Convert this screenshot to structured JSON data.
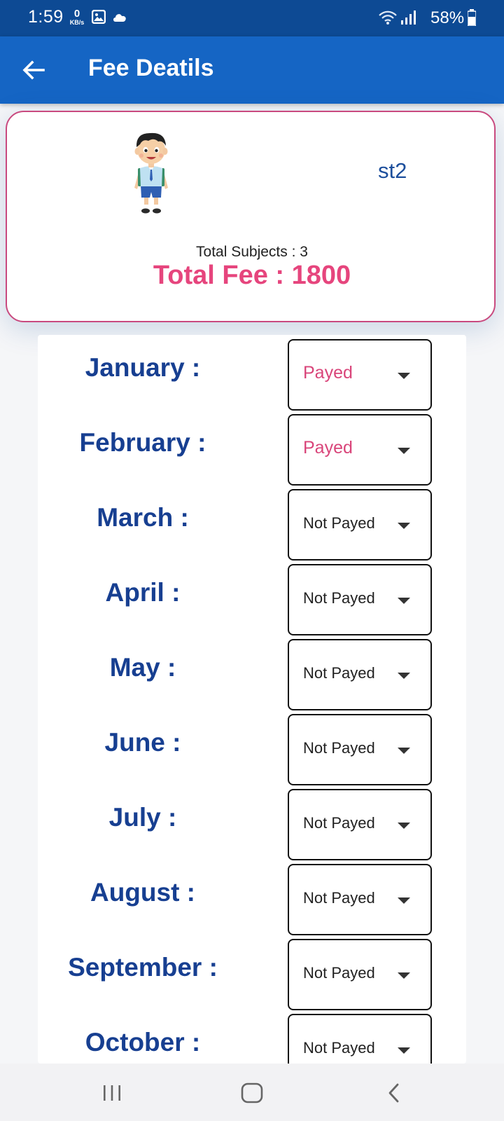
{
  "status_bar": {
    "time": "1:59",
    "data_rate_value": "0",
    "data_rate_unit": "KB/s",
    "battery_text": "58%",
    "icons": [
      "gallery-icon",
      "cloud-icon",
      "wifi-icon",
      "signal-icon",
      "battery-icon"
    ]
  },
  "app_bar": {
    "title": "Fee Deatils",
    "back_icon": "arrow-left-icon",
    "color": "#1565c4"
  },
  "profile": {
    "student_name": "st2",
    "total_subjects": "Total Subjects : 3",
    "total_fee": "Total Fee : 1800",
    "accent_color": "#e6457d"
  },
  "months": [
    {
      "label": "January :",
      "status": "Payed",
      "paid": true
    },
    {
      "label": "February :",
      "status": "Payed",
      "paid": true
    },
    {
      "label": "March :",
      "status": "Not Payed",
      "paid": false
    },
    {
      "label": "April :",
      "status": "Not Payed",
      "paid": false
    },
    {
      "label": "May :",
      "status": "Not Payed",
      "paid": false
    },
    {
      "label": "June :",
      "status": "Not Payed",
      "paid": false
    },
    {
      "label": "July :",
      "status": "Not Payed",
      "paid": false
    },
    {
      "label": "August :",
      "status": "Not Payed",
      "paid": false
    },
    {
      "label": "September :",
      "status": "Not Payed",
      "paid": false
    },
    {
      "label": "October :",
      "status": "Not Payed",
      "paid": false
    }
  ],
  "nav": {
    "icons": [
      "recent-apps-icon",
      "home-icon",
      "back-icon"
    ]
  }
}
